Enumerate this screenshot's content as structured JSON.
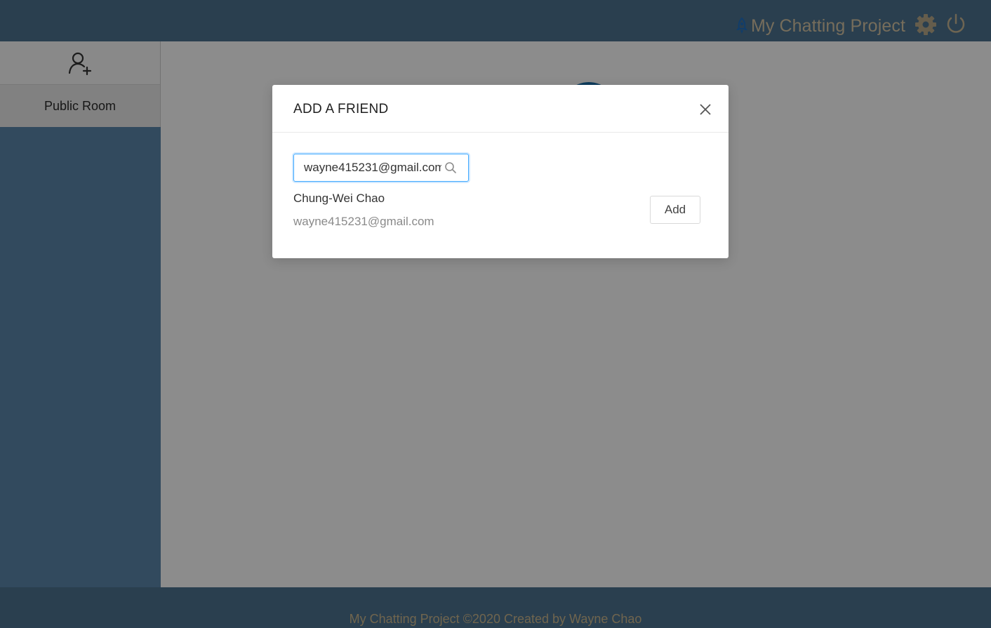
{
  "header": {
    "app_title": "My Chatting Project",
    "logo_icon": "rocket-icon",
    "settings_icon": "gear-icon",
    "logout_icon": "power-icon"
  },
  "sidebar": {
    "add_friend_icon": "add-user-icon",
    "rooms": [
      {
        "label": "Public Room"
      }
    ]
  },
  "modal": {
    "title": "ADD A FRIEND",
    "close_icon": "close-icon",
    "search": {
      "value": "wayne415231@gmail.com",
      "icon": "search-icon"
    },
    "result": {
      "name": "Chung-Wei Chao",
      "email": "wayne415231@gmail.com",
      "action_label": "Add"
    }
  },
  "footer": {
    "text": "My Chatting Project ©2020 Created by Wayne Chao"
  },
  "colors": {
    "header_bg": "#4d7391",
    "brand_text": "#d8c7a7",
    "focus_border": "#40a9ff"
  }
}
